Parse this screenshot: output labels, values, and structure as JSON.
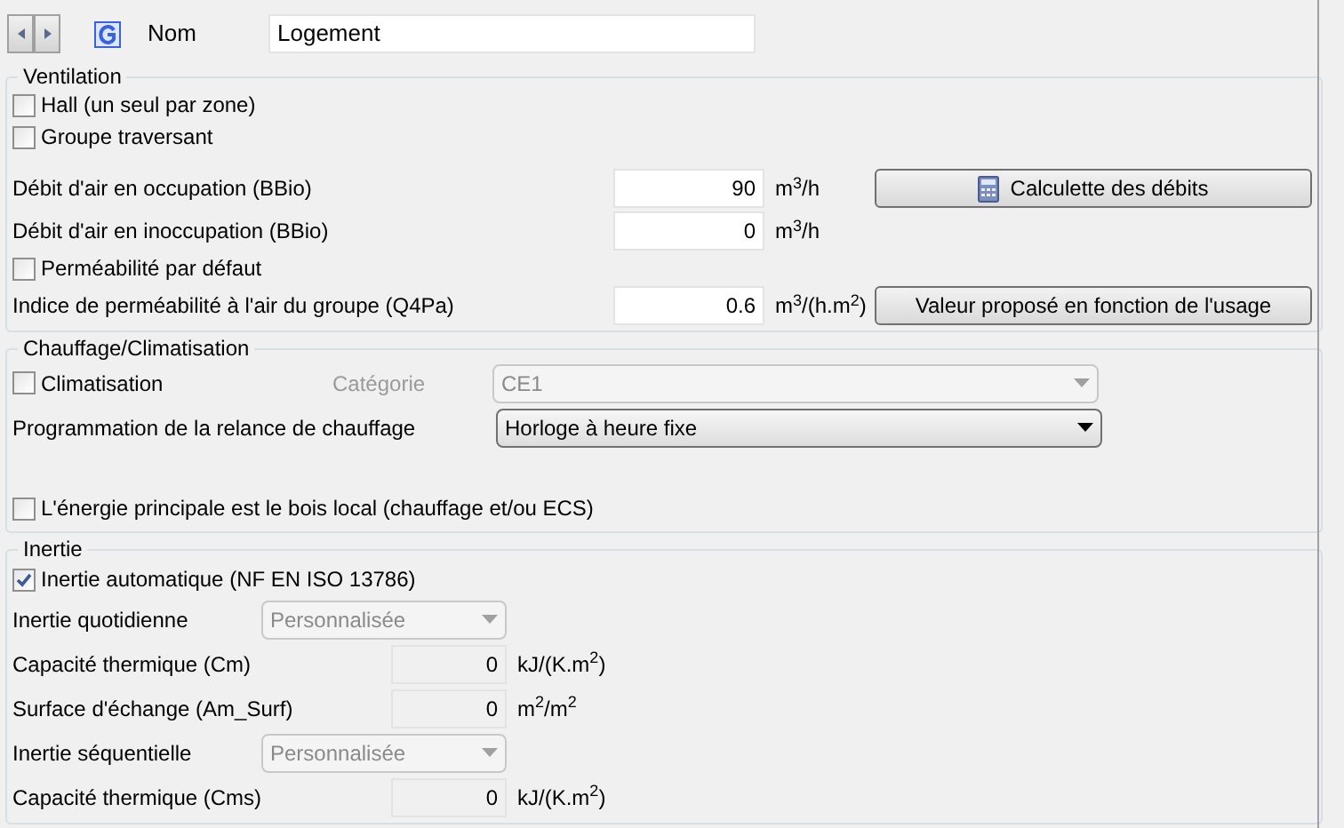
{
  "header": {
    "label": "Nom",
    "value": "Logement"
  },
  "sections": [
    {
      "title": "Ventilation",
      "rows": [
        {
          "kind": "checkbox",
          "label": "Hall (un seul par zone)",
          "checked": false
        },
        {
          "kind": "checkbox",
          "label": "Groupe traversant",
          "checked": false
        },
        {
          "kind": "number",
          "label": "Débit d'air en occupation (BBio)",
          "value": "90",
          "unit": "m$^{3}$/h",
          "disabled": false,
          "spaced": true,
          "button": {
            "label": "Calculette des débits",
            "kind": "calculator"
          }
        },
        {
          "kind": "number",
          "label": "Débit d'air en inoccupation (BBio)",
          "value": "0",
          "unit": "m$^{3}$/h",
          "disabled": false
        },
        {
          "kind": "checkbox",
          "label": "Perméabilité par défaut",
          "checked": false
        },
        {
          "kind": "number",
          "label": "Indice de perméabilité à l'air du groupe (Q4Pa)",
          "value": "0.6",
          "unit": "m$^{3}$/(h.m$^{2}$)",
          "disabled": false,
          "button": {
            "label": "Valeur proposé en fonction de l'usage",
            "kind": "plain"
          }
        }
      ]
    },
    {
      "title": "Chauffage/Climatisation",
      "rows": [
        {
          "kind": "checkbox",
          "label": "Climatisation",
          "checked": false,
          "side": {
            "label": "Catégorie",
            "value": "CE1",
            "disabled": true
          }
        },
        {
          "kind": "select",
          "label": "Programmation de la relance de chauffage",
          "value": "Horloge à heure fixe",
          "disabled": false
        },
        {
          "kind": "checkbox",
          "label": "L'énergie principale est le bois local (chauffage et/ou ECS)",
          "checked": false,
          "spaced": true
        }
      ]
    },
    {
      "title": "Inertie",
      "rows": [
        {
          "kind": "checkbox",
          "label": "Inertie automatique (NF EN ISO 13786)",
          "checked": true
        },
        {
          "kind": "select",
          "label": "Inertie quotidienne",
          "value": "Personnalisée",
          "disabled": true
        },
        {
          "kind": "number",
          "label": "Capacité thermique (Cm)",
          "value": "0",
          "unit": "kJ/(K.m$^{2}$)",
          "disabled": true
        },
        {
          "kind": "number",
          "label": "Surface d'échange (Am_Surf)",
          "value": "0",
          "unit": "m$^{2}$/m$^{2}$",
          "disabled": true
        },
        {
          "kind": "select",
          "label": "Inertie séquentielle",
          "value": "Personnalisée",
          "disabled": true
        },
        {
          "kind": "number",
          "label": "Capacité thermique (Cms)",
          "value": "0",
          "unit": "kJ/(K.m$^{2}$)",
          "disabled": true
        }
      ]
    }
  ]
}
